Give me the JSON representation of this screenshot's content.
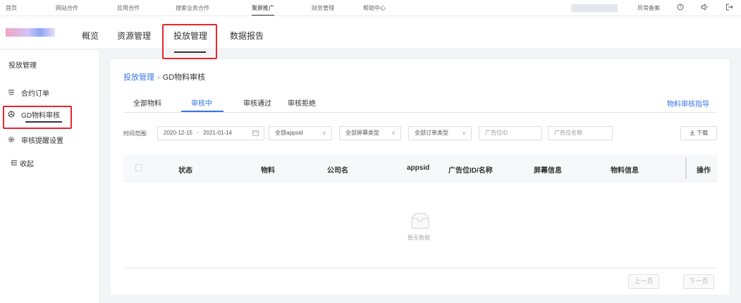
{
  "topnav": {
    "items": [
      "首页",
      "网站合作",
      "应用合作",
      "搜索业务合作",
      "聚屏推广",
      "财务管理",
      "帮助中心"
    ],
    "abnormal_filing": "异常备案",
    "help_icon": "question-icon",
    "notify_icon": "speaker-icon",
    "logout_icon": "logout-icon"
  },
  "subnav": {
    "tabs": [
      "概览",
      "资源管理",
      "投放管理",
      "数据报告"
    ]
  },
  "sidebar": {
    "title": "投放管理",
    "items": [
      {
        "label": "合约订单",
        "icon": "contract-icon"
      },
      {
        "label": "GD物料审核",
        "icon": "review-icon"
      },
      {
        "label": "审核提醒设置",
        "icon": "gear-icon"
      },
      {
        "label": "收起",
        "icon": "collapse-icon"
      }
    ]
  },
  "breadcrumb": {
    "parent": "投放管理",
    "separator": "›",
    "current": "GD物料审核"
  },
  "tabs": [
    "全部物料",
    "审核中",
    "审核通过",
    "审核拒绝"
  ],
  "guide_link": "物料审核指导",
  "filters": {
    "label": "时间范围:",
    "date_start": "2020-12-15",
    "date_sep": "~",
    "date_end": "2021-01-14",
    "appsid": "全部appsid",
    "screen_type": "全部屏幕类型",
    "order_type": "全部订单类型",
    "slot_id_placeholder": "广告位ID",
    "slot_name_placeholder": "广告位名称",
    "download": "下载"
  },
  "table": {
    "headers": [
      "状态",
      "物料",
      "公司名",
      "appsid",
      "广告位ID/名称",
      "屏幕信息",
      "物料信息",
      "操作"
    ],
    "empty_text": "暂无数据"
  },
  "pagination": {
    "prev": "上一页",
    "next": "下一页"
  },
  "colors": {
    "accent": "#3773e6",
    "highlight": "#e8262c"
  }
}
